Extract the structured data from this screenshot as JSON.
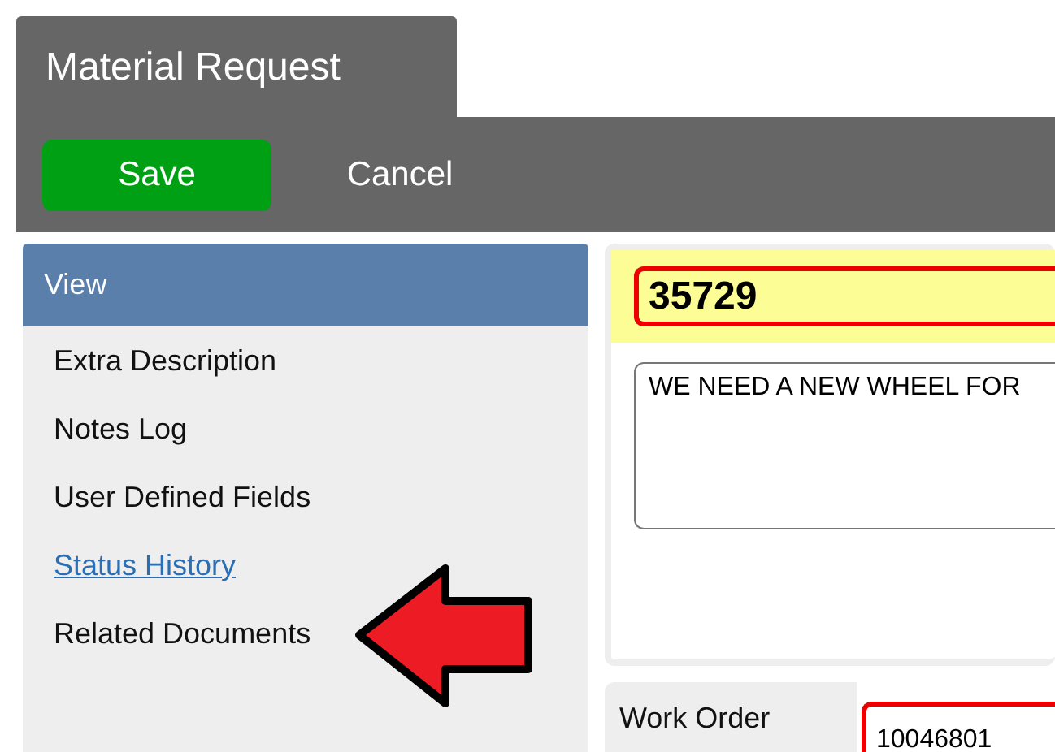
{
  "window": {
    "title": "Material Request"
  },
  "toolbar": {
    "buttons": [
      {
        "label": "Save",
        "kind": "primary"
      },
      {
        "label": "Cancel",
        "kind": "plain"
      }
    ]
  },
  "sidebar": {
    "header": "View",
    "items": [
      {
        "label": "Extra Description",
        "link": false
      },
      {
        "label": "Notes Log",
        "link": false
      },
      {
        "label": "User Defined Fields",
        "link": false
      },
      {
        "label": "Status History",
        "link": true
      },
      {
        "label": "Related Documents",
        "link": false
      }
    ]
  },
  "annotation": {
    "kind": "arrow",
    "color": "#ed1c24"
  },
  "record": {
    "number": "35729",
    "description": "WE NEED A NEW WHEEL FOR"
  },
  "fields": [
    {
      "label": "Work Order",
      "value": "10046801"
    }
  ]
}
